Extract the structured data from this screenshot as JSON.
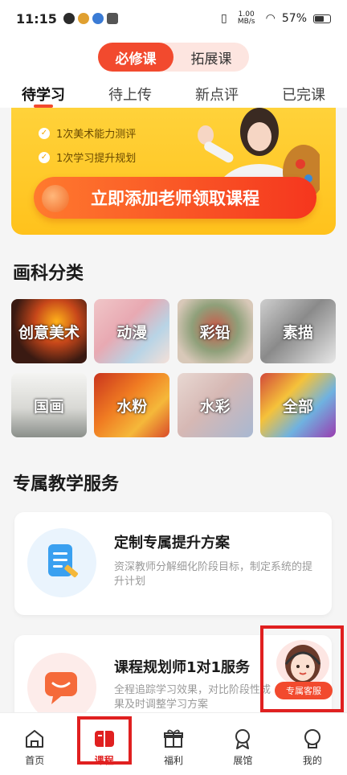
{
  "status_bar": {
    "time": "11:15",
    "net_speed": "1.00 MB/s",
    "battery": "57%"
  },
  "header": {
    "segments": [
      "必修课",
      "拓展课"
    ],
    "active_segment": 0,
    "tabs": [
      "待学习",
      "待上传",
      "新点评",
      "已完课"
    ],
    "active_tab": 0
  },
  "banner": {
    "lines": [
      "1次美术能力测评",
      "1次学习提升规划"
    ],
    "cta": "立即添加老师领取课程"
  },
  "category": {
    "title": "画科分类",
    "items": [
      "创意美术",
      "动漫",
      "彩铅",
      "素描",
      "国画",
      "水粉",
      "水彩",
      "全部"
    ]
  },
  "service": {
    "title": "专属教学服务",
    "cards": [
      {
        "title": "定制专属提升方案",
        "desc": "资深教师分解细化阶段目标，制定系统的提升计划",
        "icon": "document-edit-icon"
      },
      {
        "title": "课程规划师1对1服务",
        "desc": "全程追踪学习效果，对比阶段性成果及时调整学习方案",
        "icon": "chat-bubble-icon"
      }
    ]
  },
  "customer_service": {
    "label": "专属客服"
  },
  "tabbar": {
    "items": [
      {
        "label": "首页",
        "icon": "home-icon"
      },
      {
        "label": "课程",
        "icon": "course-book-icon"
      },
      {
        "label": "福利",
        "icon": "gift-icon"
      },
      {
        "label": "展馆",
        "icon": "medal-icon"
      },
      {
        "label": "我的",
        "icon": "profile-icon"
      }
    ],
    "active": 1
  },
  "colors": {
    "accent": "#f24a2e",
    "highlight": "#e02020",
    "banner": "#ffc21c"
  }
}
